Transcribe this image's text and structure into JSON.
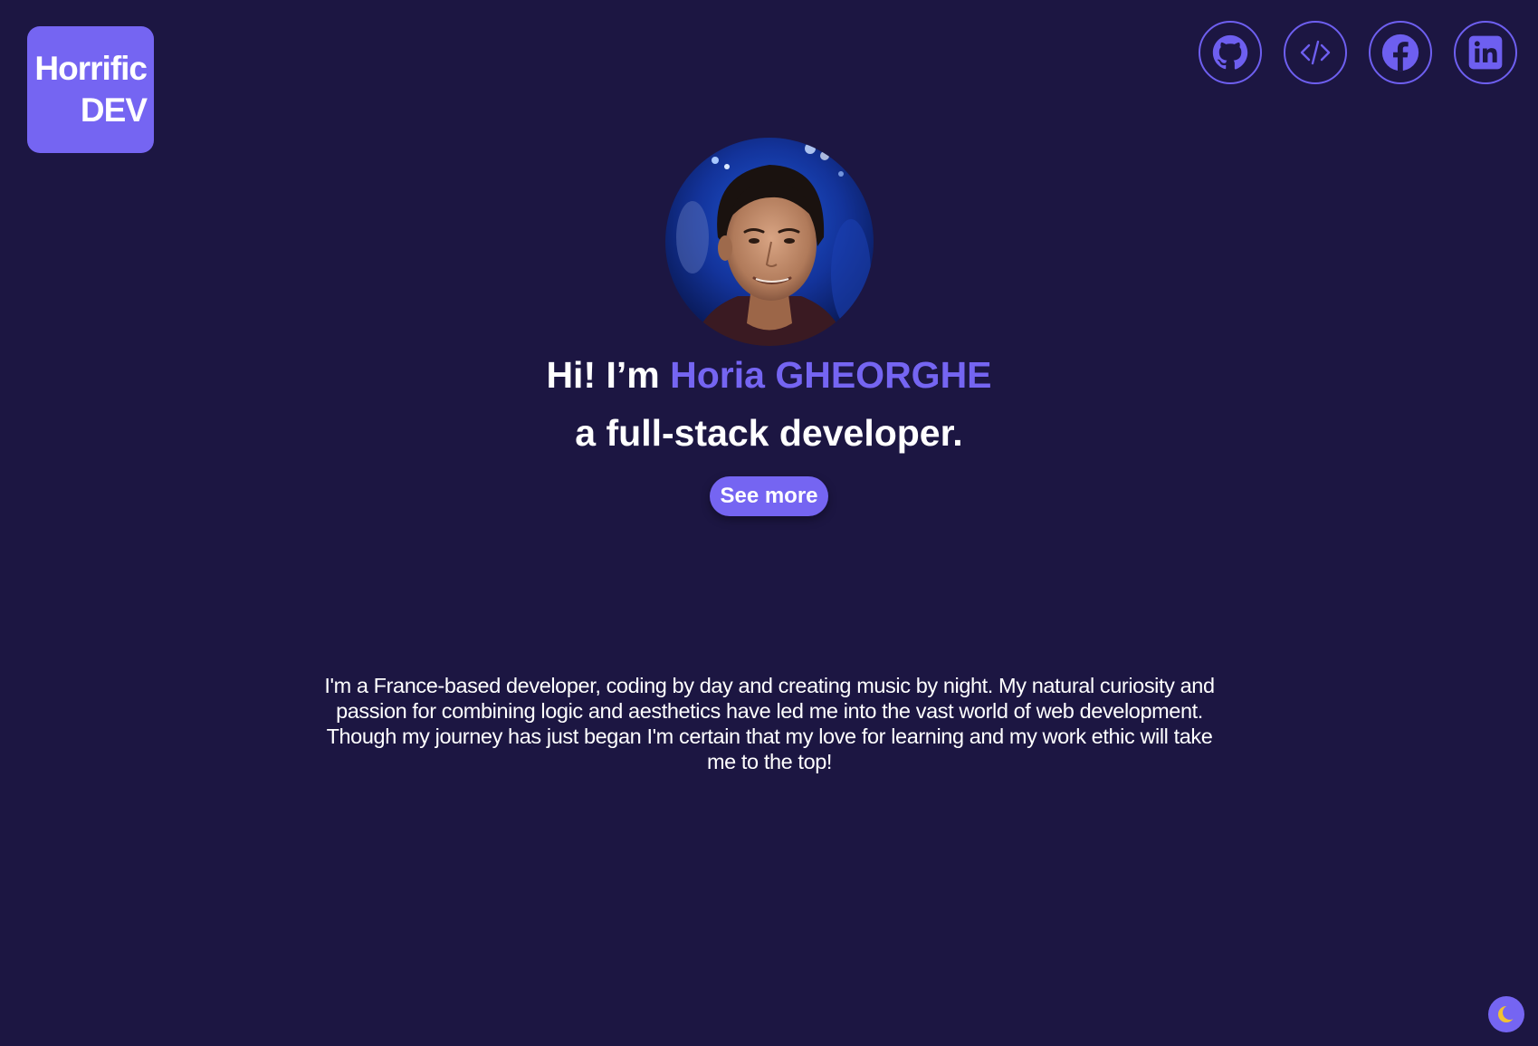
{
  "logo": {
    "line1": "Horrific",
    "line2": "DEV"
  },
  "socials": [
    {
      "name": "GitHub",
      "icon": "github-icon"
    },
    {
      "name": "Code",
      "icon": "code-icon"
    },
    {
      "name": "Facebook",
      "icon": "facebook-icon"
    },
    {
      "name": "LinkedIn",
      "icon": "linkedin-icon"
    }
  ],
  "hero": {
    "greeting_prefix": "Hi! I’m ",
    "name": "Horia GHEORGHE",
    "role": "a full-stack developer.",
    "cta_label": "See more"
  },
  "about": {
    "text": "I'm a France-based developer, coding by day and creating music by night. My natural curiosity and passion for combining logic and aesthetics have led me into the vast world of web development. Though my journey has just began I'm certain that my love for learning and my work ethic will take me to the top!"
  },
  "theme_toggle": {
    "icon": "moon-icon"
  },
  "colors": {
    "background": "#1c1642",
    "accent": "#7565f2",
    "text": "#ffffff"
  }
}
